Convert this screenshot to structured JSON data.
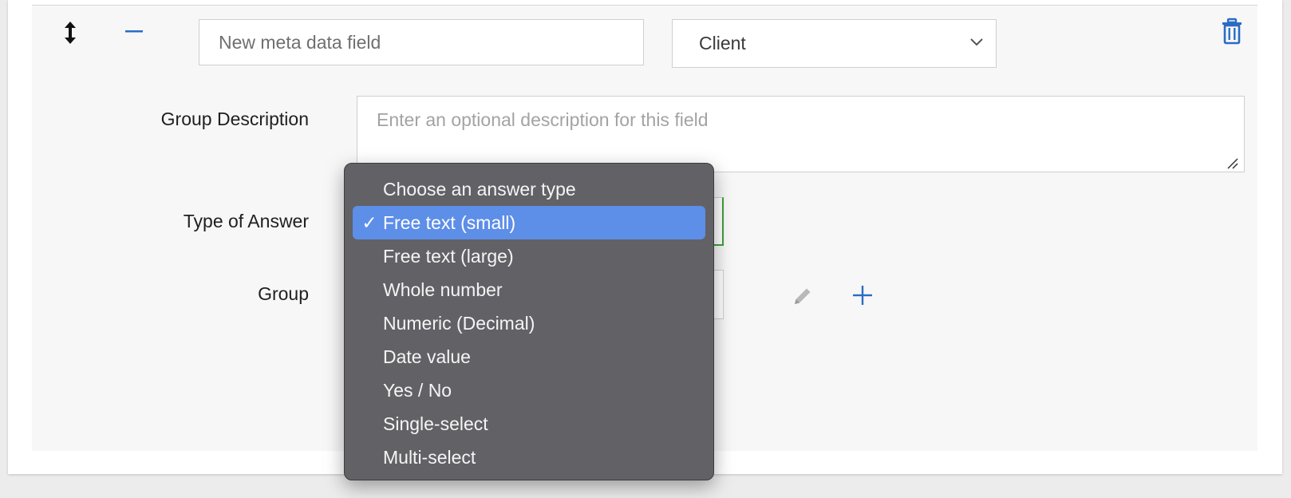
{
  "field": {
    "name_placeholder": "New meta data field",
    "scope_value": "Client"
  },
  "labels": {
    "group_description": "Group Description",
    "type_of_answer": "Type of Answer",
    "group": "Group"
  },
  "description": {
    "placeholder": "Enter an optional description for this field"
  },
  "answer_type_dropdown": {
    "selected_index": 1,
    "check_glyph": "✓",
    "options": [
      "Choose an answer type",
      "Free text (small)",
      "Free text (large)",
      "Whole number",
      "Numeric (Decimal)",
      "Date value",
      "Yes / No",
      "Single-select",
      "Multi-select"
    ]
  },
  "icons": {
    "drag": "vertical-resize-arrows-icon",
    "collapse": "minus-icon",
    "delete": "trash-icon",
    "edit": "pencil-icon",
    "add": "plus-icon"
  },
  "colors": {
    "accent_blue": "#2b6cc4",
    "selection_blue": "#5d8ee8",
    "menu_bg": "#626166",
    "valid_green": "#3fa037"
  }
}
